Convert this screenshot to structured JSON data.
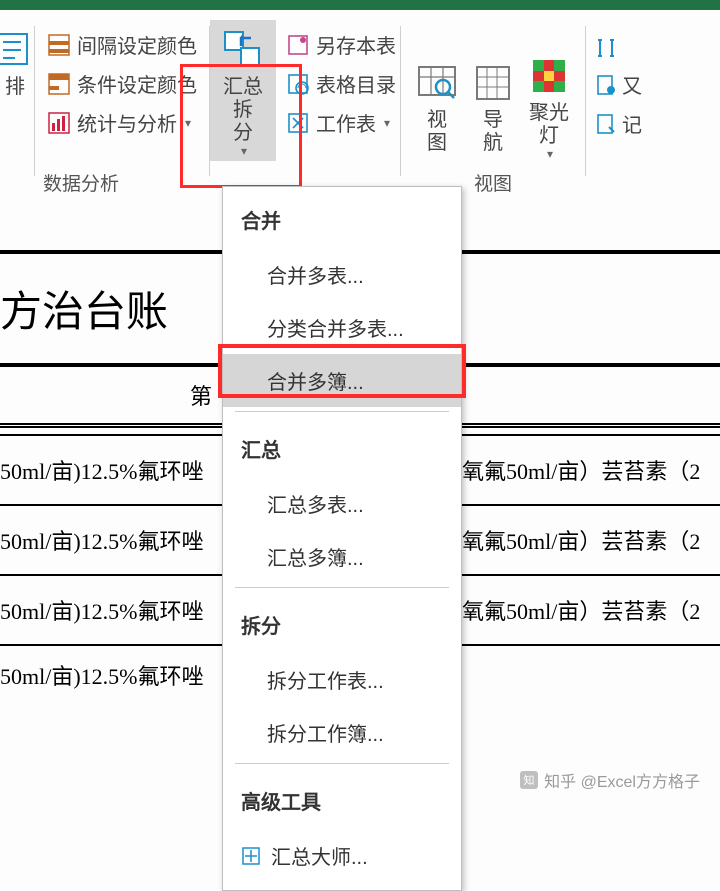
{
  "titlebar": {
    "color": "#217346"
  },
  "ribbon": {
    "left_truncated_btn": "排",
    "group_data_analysis": {
      "label": "数据分析",
      "buttons": {
        "interval_color": "间隔设定颜色",
        "conditional_color": "条件设定颜色",
        "stats_analysis": "统计与分析"
      }
    },
    "summary_split_btn": "汇总拆\n分",
    "col2": {
      "save_this_sheet": "另存本表",
      "sheet_catalog": "表格目录",
      "worksheet": "工作表"
    },
    "group_view": {
      "label": "视图",
      "view": "视\n图",
      "nav": "导\n航",
      "spotlight": "聚光\n灯"
    },
    "right_truncated": {
      "a": "又",
      "b": "记"
    }
  },
  "menu": {
    "sections": {
      "merge": {
        "header": "合并",
        "items": [
          "合并多表...",
          "分类合并多表...",
          "合并多簿..."
        ]
      },
      "summary": {
        "header": "汇总",
        "items": [
          "汇总多表...",
          "汇总多簿..."
        ]
      },
      "split": {
        "header": "拆分",
        "items": [
          "拆分工作表...",
          "拆分工作簿..."
        ]
      },
      "advanced": {
        "header": "高级工具",
        "items": [
          "汇总大师..."
        ]
      }
    }
  },
  "sheet": {
    "title_partial": "方治台账",
    "col_header_partial": "第",
    "rows_left": [
      "50ml/亩)12.5%氟环唑",
      "50ml/亩)12.5%氟环唑",
      "50ml/亩)12.5%氟环唑",
      "50ml/亩)12.5%氟环唑"
    ],
    "rows_right": [
      "氧氟50ml/亩）芸苔素（2",
      "氧氟50ml/亩）芸苔素（2",
      "氧氟50ml/亩）芸苔素（2"
    ]
  },
  "watermark": "知乎 @Excel方方格子"
}
